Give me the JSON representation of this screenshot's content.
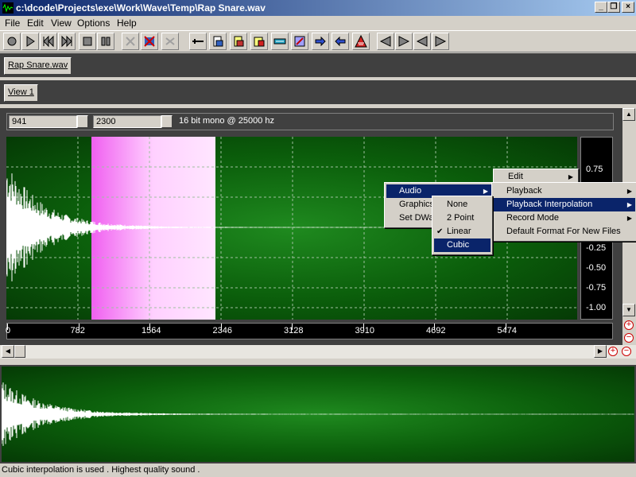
{
  "window": {
    "title": "c:\\dcode\\Projects\\exe\\Work\\Wave\\Temp\\Rap Snare.wav",
    "min_glyph": "_",
    "max_glyph": "❐",
    "close_glyph": "×"
  },
  "menubar": [
    "File",
    "Edit",
    "View",
    "Options",
    "Help"
  ],
  "toolbar": {
    "buttons": [
      "record-icon",
      "play-icon",
      "rewind-icon",
      "fast-forward-icon",
      "stop-icon",
      "pause-icon",
      "cut-icon",
      "delete-icon",
      "copy-icon",
      "trim-icon",
      "paste-icon",
      "paste-mix-icon",
      "silence-icon",
      "select-all-icon",
      "arrow-right-icon",
      "arrow-left-icon",
      "volume-icon",
      "nav-left-icon",
      "nav-right-icon",
      "nav-left2-icon",
      "nav-right2-icon"
    ]
  },
  "document_tab": "Rap Snare.wav",
  "view_tab": "View 1",
  "controls": {
    "start": "941",
    "end": "2300",
    "format": "16 bit mono @ 25000 hz"
  },
  "amplitude_ticks": [
    "0.75",
    "-0.25",
    "-0.50",
    "-0.75",
    "-1.00"
  ],
  "time_ticks": [
    "0",
    "782",
    "1564",
    "2346",
    "3128",
    "3910",
    "4692",
    "5474"
  ],
  "context_menu": {
    "root": [
      {
        "label": "Audio",
        "submenu": true,
        "highlighted": true
      },
      {
        "label": "Graphics",
        "submenu": false
      },
      {
        "label": "Set DWa",
        "submenu": false
      }
    ],
    "interpolation": [
      {
        "label": "None",
        "checked": false,
        "highlighted": false
      },
      {
        "label": "2 Point",
        "checked": false,
        "highlighted": false
      },
      {
        "label": "Linear",
        "checked": true,
        "highlighted": false
      },
      {
        "label": "Cubic",
        "checked": false,
        "highlighted": true
      }
    ],
    "edit": [
      {
        "label": "Edit",
        "submenu": true
      }
    ],
    "audio": [
      {
        "label": "Playback",
        "submenu": true,
        "highlighted": false
      },
      {
        "label": "Playback Interpolation",
        "submenu": true,
        "highlighted": true
      },
      {
        "label": "Record Mode",
        "submenu": true,
        "highlighted": false
      },
      {
        "label": "Default Format For New Files",
        "submenu": false,
        "highlighted": false
      }
    ],
    "check_glyph": "✔",
    "arrow_glyph": "▶"
  },
  "status": "Cubic interpolation is used . Highest quality sound .",
  "colors": {
    "wave_green": "#0b5e0b",
    "selection": "#ffd0ff",
    "menu_highlight": "#0a246a"
  }
}
